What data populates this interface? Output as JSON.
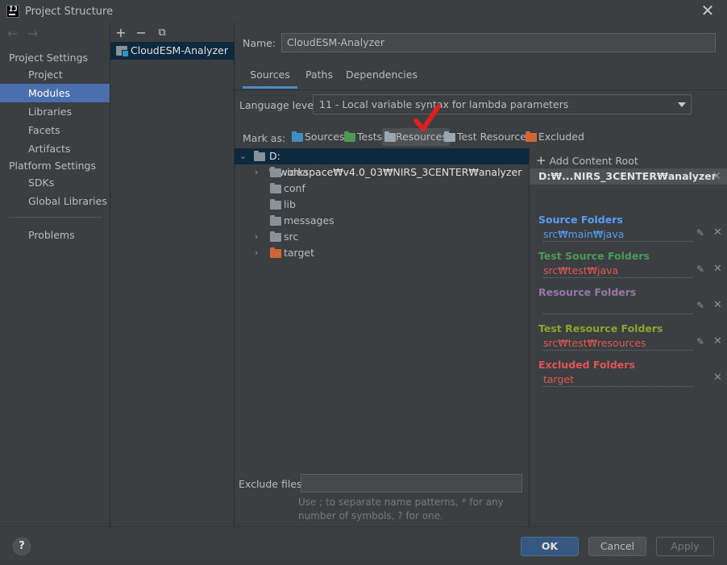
{
  "window": {
    "title": "Project Structure",
    "close_glyph": "✕"
  },
  "nav": {
    "back": "←",
    "forward": "→",
    "project_settings_label": "Project Settings",
    "project_settings_items": [
      "Project",
      "Modules",
      "Libraries",
      "Facets",
      "Artifacts"
    ],
    "platform_settings_label": "Platform Settings",
    "platform_settings_items": [
      "SDKs",
      "Global Libraries"
    ],
    "problems": "Problems",
    "selected": "Modules"
  },
  "modules": {
    "add": "+",
    "remove": "−",
    "copy": "⧉",
    "items": [
      "CloudESM-Analyzer"
    ]
  },
  "module_settings": {
    "name_label": "Name:",
    "name_value": "CloudESM-Analyzer",
    "tabs": [
      "Sources",
      "Paths",
      "Dependencies"
    ],
    "active_tab": "Sources",
    "language_level_label": "Language level:",
    "language_level_value": "11 - Local variable syntax for lambda parameters",
    "mark_as_label": "Mark as:",
    "mark_as": [
      {
        "label": "Sources",
        "color": "#3d8fc2"
      },
      {
        "label": "Tests",
        "color": "#499c54"
      },
      {
        "label": "Resources",
        "color": "#9aa7b0"
      },
      {
        "label": "Test Resources",
        "color": "#9aa7b0"
      },
      {
        "label": "Excluded",
        "color": "#d16536"
      }
    ],
    "selected_mark": "Resources"
  },
  "tree": {
    "root": "D:₩workspace₩v4.0_03₩NIRS_3CENTER₩analyzer",
    "children": [
      {
        "label": ".idea",
        "expandable": true,
        "color": "#8a9198"
      },
      {
        "label": "conf",
        "expandable": false,
        "color": "#8a9198"
      },
      {
        "label": "lib",
        "expandable": false,
        "color": "#8a9198"
      },
      {
        "label": "messages",
        "expandable": false,
        "color": "#8a9198"
      },
      {
        "label": "src",
        "expandable": true,
        "color": "#8a9198"
      },
      {
        "label": "target",
        "expandable": true,
        "color": "#d16536"
      }
    ]
  },
  "exclude": {
    "label": "Exclude files:",
    "value": "",
    "hint": "Use ; to separate name patterns, * for any number of symbols, ? for one."
  },
  "content_roots": {
    "add_label": "Add Content Root",
    "root_header": "D:₩...NIRS_3CENTER₩analyzer",
    "groups": [
      {
        "title": "Source Folders",
        "path": "src₩main₩java",
        "title_color": "#589df6",
        "path_color": "#589df6",
        "editable": true
      },
      {
        "title": "Test Source Folders",
        "path": "src₩test₩java",
        "title_color": "#499c54",
        "path_color": "#e05555",
        "editable": true
      },
      {
        "title": "Resource Folders",
        "path": "",
        "title_color": "#9876aa",
        "path_color": "#9876aa",
        "editable": true
      },
      {
        "title": "Test Resource Folders",
        "path": "src₩test₩resources",
        "title_color": "#8ca42b",
        "path_color": "#e05555",
        "editable": true
      },
      {
        "title": "Excluded Folders",
        "path": "target",
        "title_color": "#e05555",
        "path_color": "#e05555",
        "editable": false
      }
    ]
  },
  "footer": {
    "help": "?",
    "ok": "OK",
    "cancel": "Cancel",
    "apply": "Apply"
  }
}
